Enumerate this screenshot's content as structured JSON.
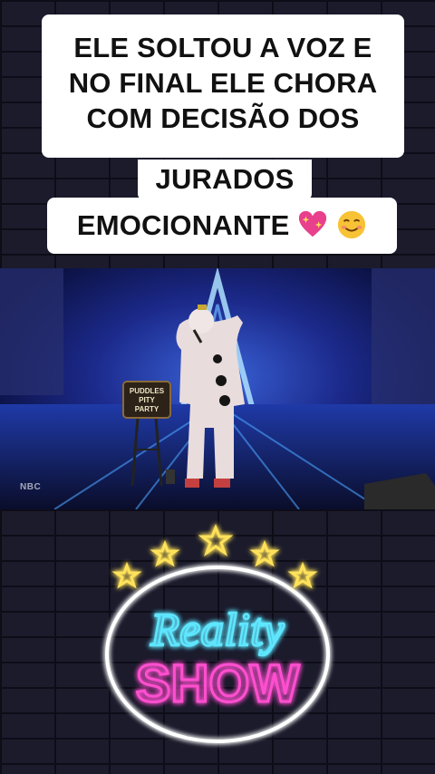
{
  "caption": {
    "line1": "ELE SOLTOU A VOZ E",
    "line2": "NO FINAL ELE CHORA",
    "line3": "COM DECISÃO DOS",
    "line4": "JURADOS",
    "line5": "EMOCIONANTE"
  },
  "emojis": [
    "sparkling-heart",
    "smiling-face"
  ],
  "video": {
    "sign_line1": "PUDDLES",
    "sign_line2": "PITY",
    "sign_line3": "PARTY",
    "network_watermark": "NBC"
  },
  "neon_logo": {
    "word1": "Reality",
    "word2": "SHOW",
    "colors": {
      "stars": "#ffe25a",
      "ring": "#ffffff",
      "reality": "#5fe6ff",
      "show": "#ff4fd0"
    }
  },
  "colors": {
    "caption_bg": "#ffffff",
    "caption_text": "#111111",
    "wall": "#1b1b2c"
  }
}
